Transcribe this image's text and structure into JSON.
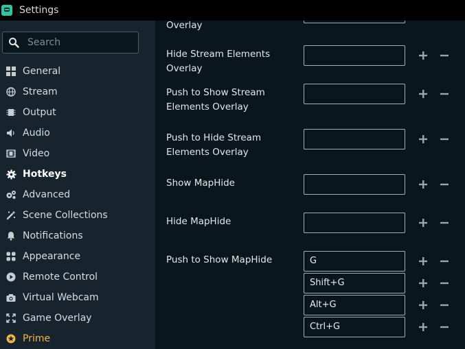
{
  "window": {
    "title": "Settings"
  },
  "search": {
    "placeholder": "Search"
  },
  "sidebar": {
    "items": [
      {
        "label": "General",
        "icon": "general-icon"
      },
      {
        "label": "Stream",
        "icon": "globe-icon"
      },
      {
        "label": "Output",
        "icon": "chip-icon"
      },
      {
        "label": "Audio",
        "icon": "speaker-icon"
      },
      {
        "label": "Video",
        "icon": "film-icon"
      },
      {
        "label": "Hotkeys",
        "icon": "gear-icon",
        "active": true
      },
      {
        "label": "Advanced",
        "icon": "gears-icon"
      },
      {
        "label": "Scene Collections",
        "icon": "wand-icon"
      },
      {
        "label": "Notifications",
        "icon": "bell-icon"
      },
      {
        "label": "Appearance",
        "icon": "palette-icon"
      },
      {
        "label": "Remote Control",
        "icon": "play-circle-icon"
      },
      {
        "label": "Virtual Webcam",
        "icon": "camera-icon"
      },
      {
        "label": "Game Overlay",
        "icon": "expand-icon"
      },
      {
        "label": "Prime",
        "icon": "star-icon"
      }
    ]
  },
  "hotkeys": {
    "partial_label": "Overlay",
    "rows": [
      {
        "label": "Hide Stream Elements Overlay",
        "bindings": [
          ""
        ]
      },
      {
        "label": "Push to Show Stream Elements Overlay",
        "bindings": [
          ""
        ]
      },
      {
        "label": "Push to Hide Stream Elements Overlay",
        "bindings": [
          ""
        ]
      },
      {
        "label": "Show MapHide",
        "bindings": [
          ""
        ]
      },
      {
        "label": "Hide MapHide",
        "bindings": [
          ""
        ]
      },
      {
        "label": "Push to Show MapHide",
        "bindings": [
          "G",
          "Shift+G",
          "Alt+G",
          "Ctrl+G"
        ]
      }
    ]
  },
  "colors": {
    "sidebar_bg": "#17242d",
    "content_bg": "#09161d",
    "prime": "#f0b54d",
    "accent": "#31c3a2"
  }
}
